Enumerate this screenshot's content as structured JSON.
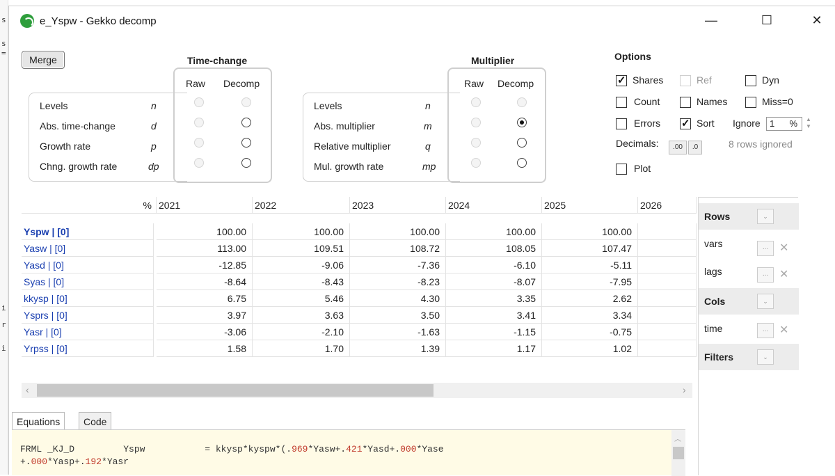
{
  "window": {
    "title": "e_Yspw - Gekko decomp"
  },
  "leftstrip": [
    "s",
    "s",
    "=",
    "i",
    "r",
    "i"
  ],
  "merge_label": "Merge",
  "time_change": {
    "title": "Time-change",
    "col_raw": "Raw",
    "col_decomp": "Decomp",
    "rows": [
      {
        "label": "Levels",
        "sym": "n"
      },
      {
        "label": "Abs. time-change",
        "sym": "d"
      },
      {
        "label": "Growth rate",
        "sym": "p"
      },
      {
        "label": "Chng. growth rate",
        "sym": "dp"
      }
    ]
  },
  "multiplier": {
    "title": "Multiplier",
    "col_raw": "Raw",
    "col_decomp": "Decomp",
    "rows": [
      {
        "label": "Levels",
        "sym": "n"
      },
      {
        "label": "Abs. multiplier",
        "sym": "m"
      },
      {
        "label": "Relative multiplier",
        "sym": "q"
      },
      {
        "label": "Mul. growth rate",
        "sym": "mp"
      }
    ],
    "selected": "Abs. multiplier"
  },
  "options": {
    "title": "Options",
    "shares": "Shares",
    "ref": "Ref",
    "dyn": "Dyn",
    "count": "Count",
    "names": "Names",
    "miss": "Miss=0",
    "errors": "Errors",
    "sort": "Sort",
    "ignore": "Ignore",
    "ignore_value": "1",
    "ignore_unit": "%",
    "decimals": "Decimals:",
    "dec_more": ".00",
    "dec_less": ".0",
    "rows_ignored": "8 rows ignored",
    "plot": "Plot"
  },
  "table": {
    "corner": "%",
    "columns": [
      "2021",
      "2022",
      "2023",
      "2024",
      "2025",
      "2026"
    ],
    "rows": [
      {
        "name": "Yspw | [0]",
        "values": [
          "100.00",
          "100.00",
          "100.00",
          "100.00",
          "100.00",
          ""
        ]
      },
      {
        "name": "Yasw | [0]",
        "values": [
          "113.00",
          "109.51",
          "108.72",
          "108.05",
          "107.47",
          ""
        ]
      },
      {
        "name": "Yasd | [0]",
        "values": [
          "-12.85",
          "-9.06",
          "-7.36",
          "-6.10",
          "-5.11",
          ""
        ]
      },
      {
        "name": "Syas | [0]",
        "values": [
          "-8.64",
          "-8.43",
          "-8.23",
          "-8.07",
          "-7.95",
          ""
        ]
      },
      {
        "name": "kkysp | [0]",
        "values": [
          "6.75",
          "5.46",
          "4.30",
          "3.35",
          "2.62",
          ""
        ]
      },
      {
        "name": "Ysprs | [0]",
        "values": [
          "3.97",
          "3.63",
          "3.50",
          "3.41",
          "3.34",
          ""
        ]
      },
      {
        "name": "Yasr | [0]",
        "values": [
          "-3.06",
          "-2.10",
          "-1.63",
          "-1.15",
          "-0.75",
          ""
        ]
      },
      {
        "name": "Yrpss | [0]",
        "values": [
          "1.58",
          "1.70",
          "1.39",
          "1.17",
          "1.02",
          ""
        ]
      }
    ]
  },
  "side": {
    "rows": "Rows",
    "vars": "vars",
    "lags": "lags",
    "cols": "Cols",
    "time": "time",
    "filters": "Filters",
    "ellipsis": "...",
    "close": "✕",
    "dropdown": "⌄"
  },
  "tabs": [
    "Equations",
    "Code"
  ],
  "code": {
    "line1_a": "FRML _KJ_D         Yspw           = kkysp*kyspw*(.",
    "n1": "969",
    "s1": "*Yasw+.",
    "n2": "421",
    "s2": "*Yasd+.",
    "n3": "000",
    "s3": "*Yase",
    "line2_a": "+.",
    "n4": "000",
    "s4": "*Yasp+.",
    "n5": "192",
    "s5": "*Yasr"
  }
}
